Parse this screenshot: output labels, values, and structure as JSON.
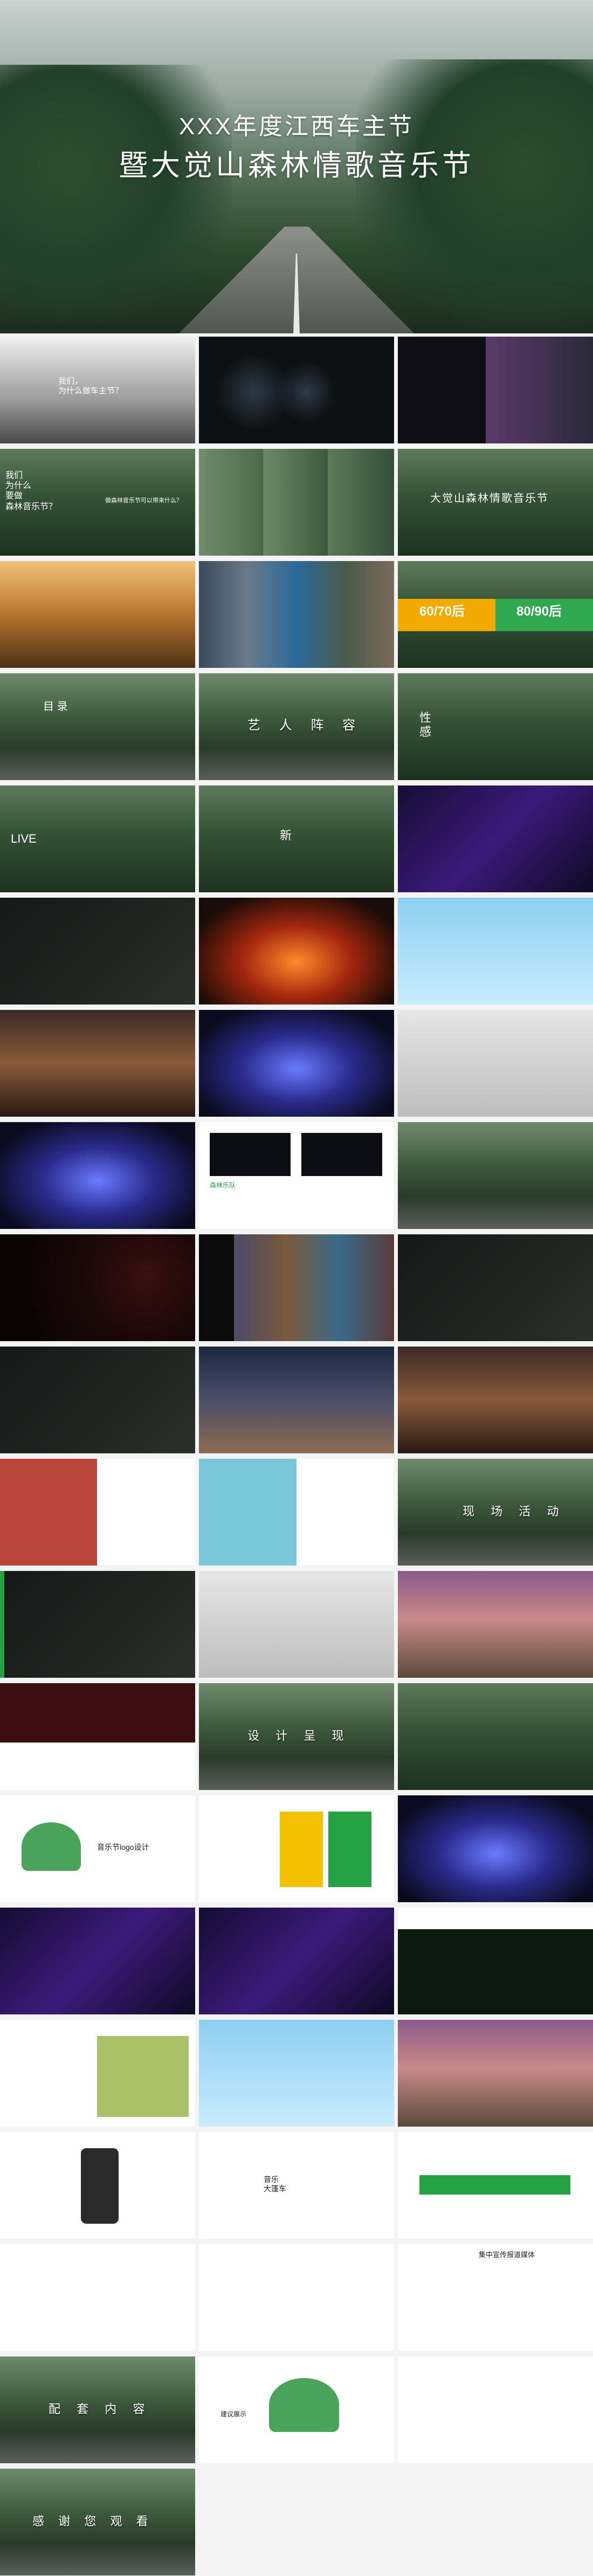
{
  "hero": {
    "title_line1": "XXX年度江西车主节",
    "title_line2": "暨大觉山森林情歌音乐节"
  },
  "slides": {
    "why_car": "我们，\n为什么做车主节？",
    "why_music": "我们\n为什么\n要做\n森林音乐节？",
    "music_question": "做森林音乐节可以带来什么？",
    "festival_title": "大觉山森林情歌音乐节",
    "gen_60_70": "60/70后",
    "gen_80_90": "80/90后",
    "contents_title": "目 录",
    "artist_mark": "艺 人 阵 容",
    "character_mark": "性\n感",
    "live_mark": "LIVE",
    "new_mark": "新",
    "scene_mark": "现 场 活 动",
    "design_mark": "设 计 呈 现",
    "logo_design": "音乐节logo设计",
    "forest_band": "森林乐队",
    "music_truck": "音乐\n大篷车",
    "media_title": "集中宣传报道媒体",
    "package_mark": "配 套 内 容",
    "thanks_mark": "感 谢 您 观 看",
    "suggest": "建议展示"
  },
  "colors": {
    "accent_green": "#25a244",
    "gen_60_70_bg": "#f2a900",
    "gen_80_90_bg": "#2fa84f"
  }
}
